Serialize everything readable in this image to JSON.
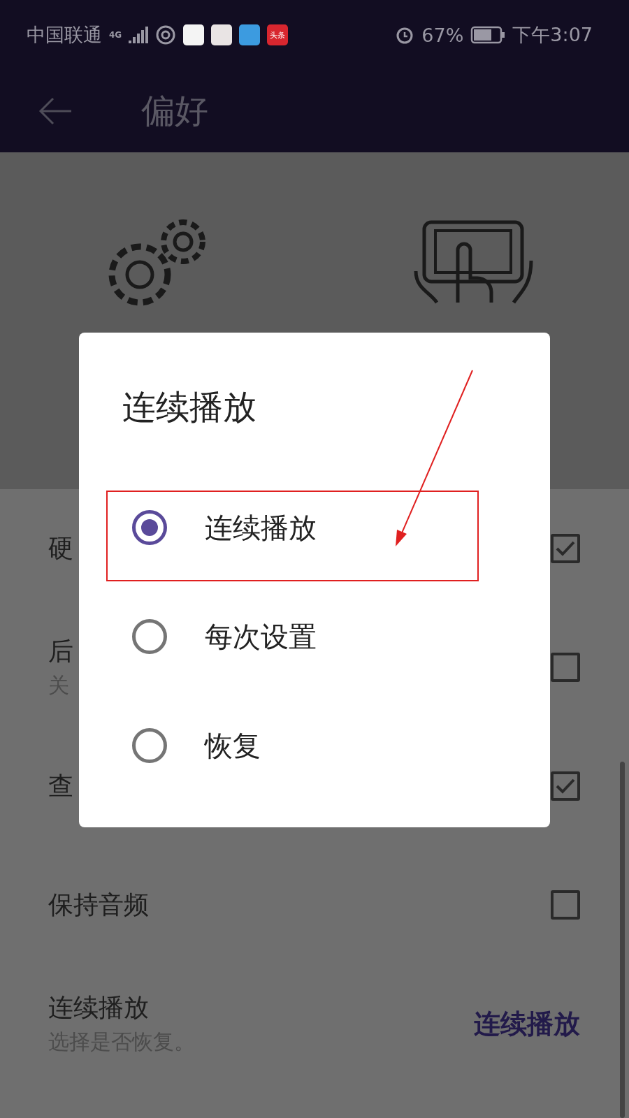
{
  "status_bar": {
    "carrier": "中国联通",
    "network": "4G",
    "app_badge": "头条",
    "battery": "67%",
    "time": "下午3:07"
  },
  "toolbar": {
    "title": "偏好"
  },
  "rows": [
    {
      "kind": "checkbox",
      "title": "硬",
      "checked": true
    },
    {
      "kind": "checkbox",
      "title": "后",
      "subtitle": "关",
      "checked": false
    },
    {
      "kind": "checkbox",
      "title": "查",
      "checked": true
    },
    {
      "kind": "checkbox",
      "title": "保持音频",
      "checked": false
    },
    {
      "kind": "value",
      "title": "连续播放",
      "subtitle": "选择是否恢复。",
      "value": "连续播放"
    }
  ],
  "dialog": {
    "title": "连续播放",
    "options": [
      {
        "label": "连续播放",
        "selected": true
      },
      {
        "label": "每次设置",
        "selected": false
      },
      {
        "label": "恢复",
        "selected": false
      }
    ]
  }
}
